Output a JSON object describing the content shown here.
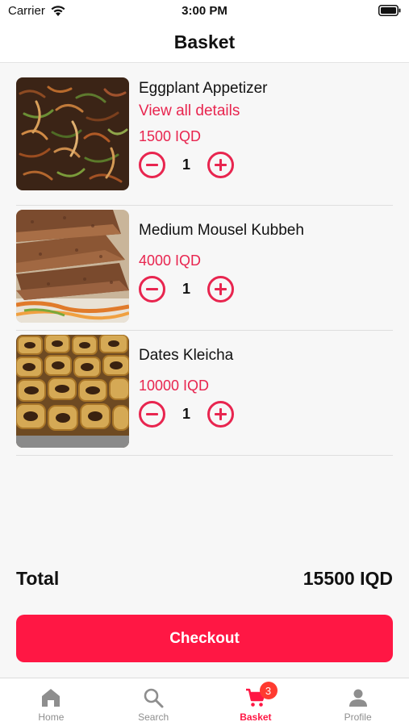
{
  "status_bar": {
    "carrier": "Carrier",
    "time": "3:00 PM"
  },
  "header": {
    "title": "Basket"
  },
  "items": [
    {
      "name": "Eggplant Appetizer",
      "details_link": "View all details",
      "price": "1500 IQD",
      "quantity": "1"
    },
    {
      "name": "Medium Mousel Kubbeh",
      "price": "4000 IQD",
      "quantity": "1"
    },
    {
      "name": "Dates Kleicha",
      "price": "10000 IQD",
      "quantity": "1"
    }
  ],
  "summary": {
    "total_label": "Total",
    "total_value": "15500 IQD"
  },
  "checkout": {
    "label": "Checkout"
  },
  "tabs": [
    {
      "label": "Home",
      "icon": "home-icon"
    },
    {
      "label": "Search",
      "icon": "search-icon"
    },
    {
      "label": "Basket",
      "icon": "cart-icon",
      "badge": "3",
      "active": true
    },
    {
      "label": "Profile",
      "icon": "person-icon"
    }
  ],
  "colors": {
    "accent": "#ff1744",
    "price": "#e8254f",
    "badge": "#ff3b30",
    "inactive_tab": "#8e8e8e"
  }
}
